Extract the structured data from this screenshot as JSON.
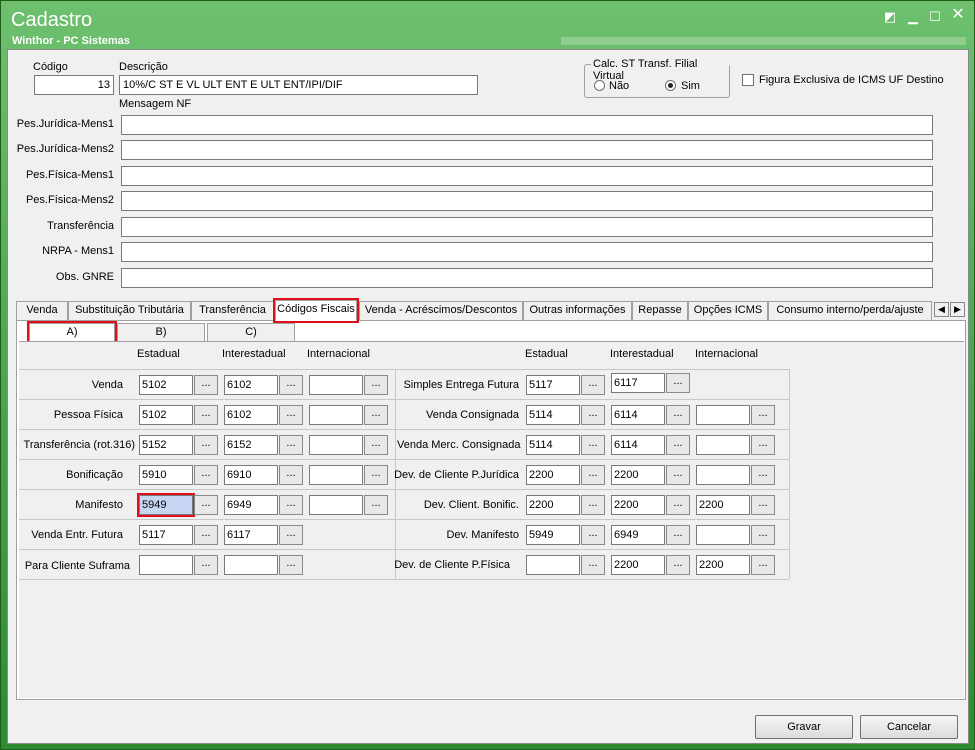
{
  "window": {
    "title": "Cadastro",
    "subtitle": "Winthor - PC Sistemas"
  },
  "header": {
    "codigo_label": "Código",
    "codigo_value": "13",
    "descricao_label": "Descrição",
    "descricao_value": "10%/C ST E VL ULT ENT E ULT ENT/IPI/DIF",
    "calc_st_title": "Calc. ST Transf. Filial Virtual",
    "radio_nao": "Não",
    "radio_sim": "Sim",
    "figura_label": "Figura Exclusiva de ICMS UF Destino",
    "mensagem_nf_label": "Mensagem NF"
  },
  "messages": [
    {
      "label": "Pes.Jurídica-Mens1",
      "value": ""
    },
    {
      "label": "Pes.Jurídica-Mens2",
      "value": ""
    },
    {
      "label": "Pes.Física-Mens1",
      "value": ""
    },
    {
      "label": "Pes.Física-Mens2",
      "value": ""
    },
    {
      "label": "Transferência",
      "value": ""
    },
    {
      "label": "NRPA - Mens1",
      "value": ""
    },
    {
      "label": "Obs. GNRE",
      "value": ""
    }
  ],
  "tabs": [
    "Venda",
    "Substituição Tributária",
    "Transferência",
    "Códigos Fiscais",
    "Venda - Acréscimos/Descontos",
    "Outras informações",
    "Repasse",
    "Opções ICMS",
    "Consumo interno/perda/ajuste"
  ],
  "subtabs": [
    "A)",
    "B)",
    "C)"
  ],
  "columns": {
    "estadual": "Estadual",
    "interestadual": "Interestadual",
    "internacional": "Internacional"
  },
  "left_rows": [
    {
      "label": "Venda",
      "est": "5102",
      "inter": "6102",
      "intl": ""
    },
    {
      "label": "Pessoa Física",
      "est": "5102",
      "inter": "6102",
      "intl": ""
    },
    {
      "label": "Transferência (rot.316)",
      "est": "5152",
      "inter": "6152",
      "intl": ""
    },
    {
      "label": "Bonificação",
      "est": "5910",
      "inter": "6910",
      "intl": ""
    },
    {
      "label": "Manifesto",
      "est": "5949",
      "inter": "6949",
      "intl": ""
    },
    {
      "label": "Venda Entr. Futura",
      "est": "5117",
      "inter": "6117"
    },
    {
      "label": "Para Cliente Suframa",
      "est": "",
      "inter": ""
    }
  ],
  "right_rows": [
    {
      "label": "Simples Entrega Futura",
      "est": "5117",
      "inter": "6117"
    },
    {
      "label": "Venda Consignada",
      "est": "5114",
      "inter": "6114",
      "intl": ""
    },
    {
      "label": "Venda Merc. Consignada",
      "est": "5114",
      "inter": "6114",
      "intl": ""
    },
    {
      "label": "Dev. de Cliente P.Jurídica",
      "est": "2200",
      "inter": "2200",
      "intl": ""
    },
    {
      "label": "Dev. Client. Bonific.",
      "est": "2200",
      "inter": "2200",
      "intl": "2200"
    },
    {
      "label": "Dev. Manifesto",
      "est": "5949",
      "inter": "6949",
      "intl": ""
    },
    {
      "label": "Dev. de Cliente P.Física",
      "est": "",
      "inter": "2200",
      "intl": "2200"
    }
  ],
  "ellipsis": "...",
  "buttons": {
    "gravar": "Gravar",
    "cancelar": "Cancelar"
  }
}
